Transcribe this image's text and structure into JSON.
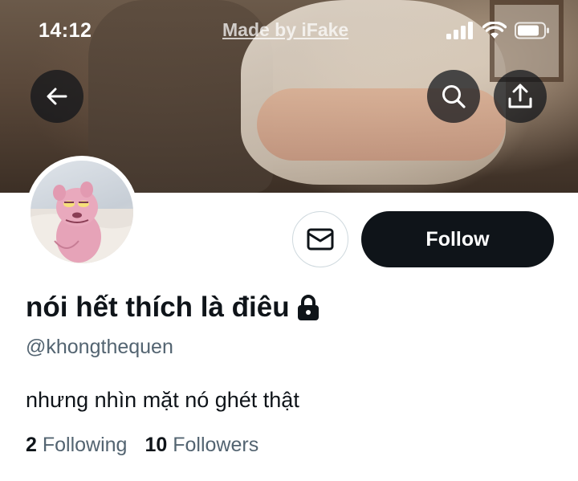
{
  "status_bar": {
    "time": "14:12",
    "center_text": "Made by iFake",
    "icons": [
      "cellular-signal-icon",
      "wifi-icon",
      "battery-icon"
    ]
  },
  "header": {
    "banner": "header-photo",
    "back_icon": "arrow-left-icon",
    "search_icon": "search-icon",
    "share_icon": "share-upload-icon"
  },
  "profile": {
    "avatar": "pink-panther-avatar",
    "message_icon": "envelope-icon",
    "follow_label": "Follow",
    "display_name": "nói hết thích là điêu",
    "protected_icon": "lock-icon",
    "handle": "@khongthequen",
    "bio": "nhưng nhìn mặt nó ghét thật",
    "stats": {
      "following_count": "2",
      "following_label": "Following",
      "followers_count": "10",
      "followers_label": "Followers"
    }
  },
  "colors": {
    "primary_text": "#0f1419",
    "secondary_text": "#536471",
    "follow_bg": "#0f1419",
    "follow_text": "#ffffff",
    "border": "#cfd9de"
  }
}
